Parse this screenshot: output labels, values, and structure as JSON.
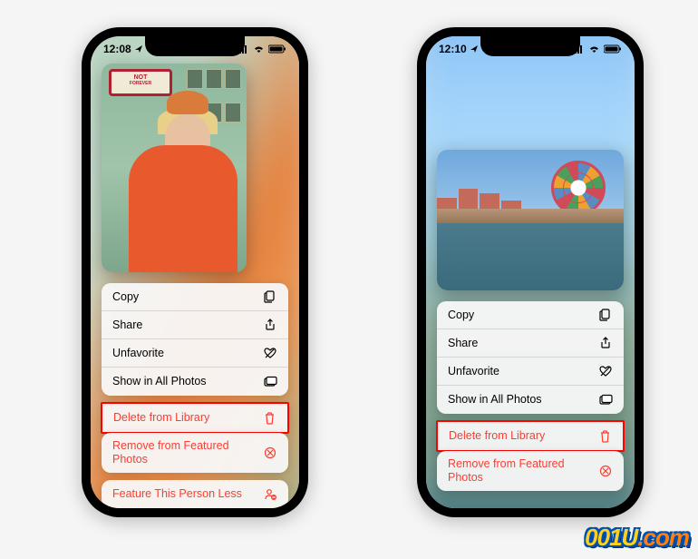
{
  "phone1": {
    "time": "12:08",
    "sign_line1": "NOT",
    "sign_line2": "FOREVER",
    "menu": {
      "copy": "Copy",
      "share": "Share",
      "unfavorite": "Unfavorite",
      "show_all": "Show in All Photos",
      "delete": "Delete from Library",
      "remove_featured": "Remove from Featured Photos",
      "feature_less": "Feature This Person Less"
    }
  },
  "phone2": {
    "time": "12:10",
    "menu": {
      "copy": "Copy",
      "share": "Share",
      "unfavorite": "Unfavorite",
      "show_all": "Show in All Photos",
      "delete": "Delete from Library",
      "remove_featured": "Remove from Featured Photos"
    }
  },
  "watermark": "001U.com"
}
